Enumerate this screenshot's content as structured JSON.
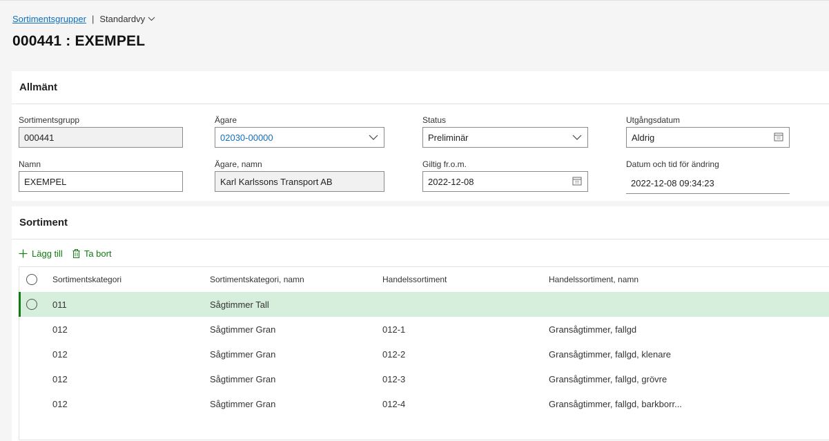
{
  "breadcrumb": {
    "link": "Sortimentsgrupper",
    "separator": "|",
    "view": "Standardvy"
  },
  "page": {
    "title": "000441 : EXEMPEL"
  },
  "general": {
    "header": "Allmänt",
    "fields": {
      "sortimentsgrupp": {
        "label": "Sortimentsgrupp",
        "value": "000441"
      },
      "agare": {
        "label": "Ägare",
        "value": "02030-00000"
      },
      "status": {
        "label": "Status",
        "value": "Preliminär"
      },
      "utgangsdatum": {
        "label": "Utgångsdatum",
        "value": "Aldrig"
      },
      "namn": {
        "label": "Namn",
        "value": "EXEMPEL"
      },
      "agare_namn": {
        "label": "Ägare, namn",
        "value": "Karl Karlssons Transport AB"
      },
      "giltig": {
        "label": "Giltig fr.o.m.",
        "value": "2022-12-08"
      },
      "andring": {
        "label": "Datum och tid för ändring",
        "value": "2022-12-08 09:34:23"
      }
    }
  },
  "assortment": {
    "header": "Sortiment",
    "toolbar": {
      "add": "Lägg till",
      "remove": "Ta bort"
    },
    "columns": [
      "Sortimentskategori",
      "Sortimentskategori, namn",
      "Handelssortiment",
      "Handelssortiment, namn"
    ],
    "rows": [
      [
        "011",
        "Sågtimmer Tall",
        "",
        ""
      ],
      [
        "012",
        "Sågtimmer Gran",
        "012-1",
        "Gransågtimmer, fallgd"
      ],
      [
        "012",
        "Sågtimmer Gran",
        "012-2",
        "Gransågtimmer, fallgd, klenare"
      ],
      [
        "012",
        "Sågtimmer Gran",
        "012-3",
        "Gransågtimmer, fallgd, grövre"
      ],
      [
        "012",
        "Sågtimmer Gran",
        "012-4",
        "Gransågtimmer, fallgd, barkborr..."
      ]
    ]
  },
  "colors": {
    "accent": "#107c10",
    "link": "#106ebe",
    "selected_row": "#d6eedc"
  },
  "icons": {
    "view_chevron": "chevron-down-icon",
    "dropdown": "chevron-down-icon",
    "calendar": "calendar-icon",
    "add": "plus-icon",
    "remove": "trash-icon"
  }
}
